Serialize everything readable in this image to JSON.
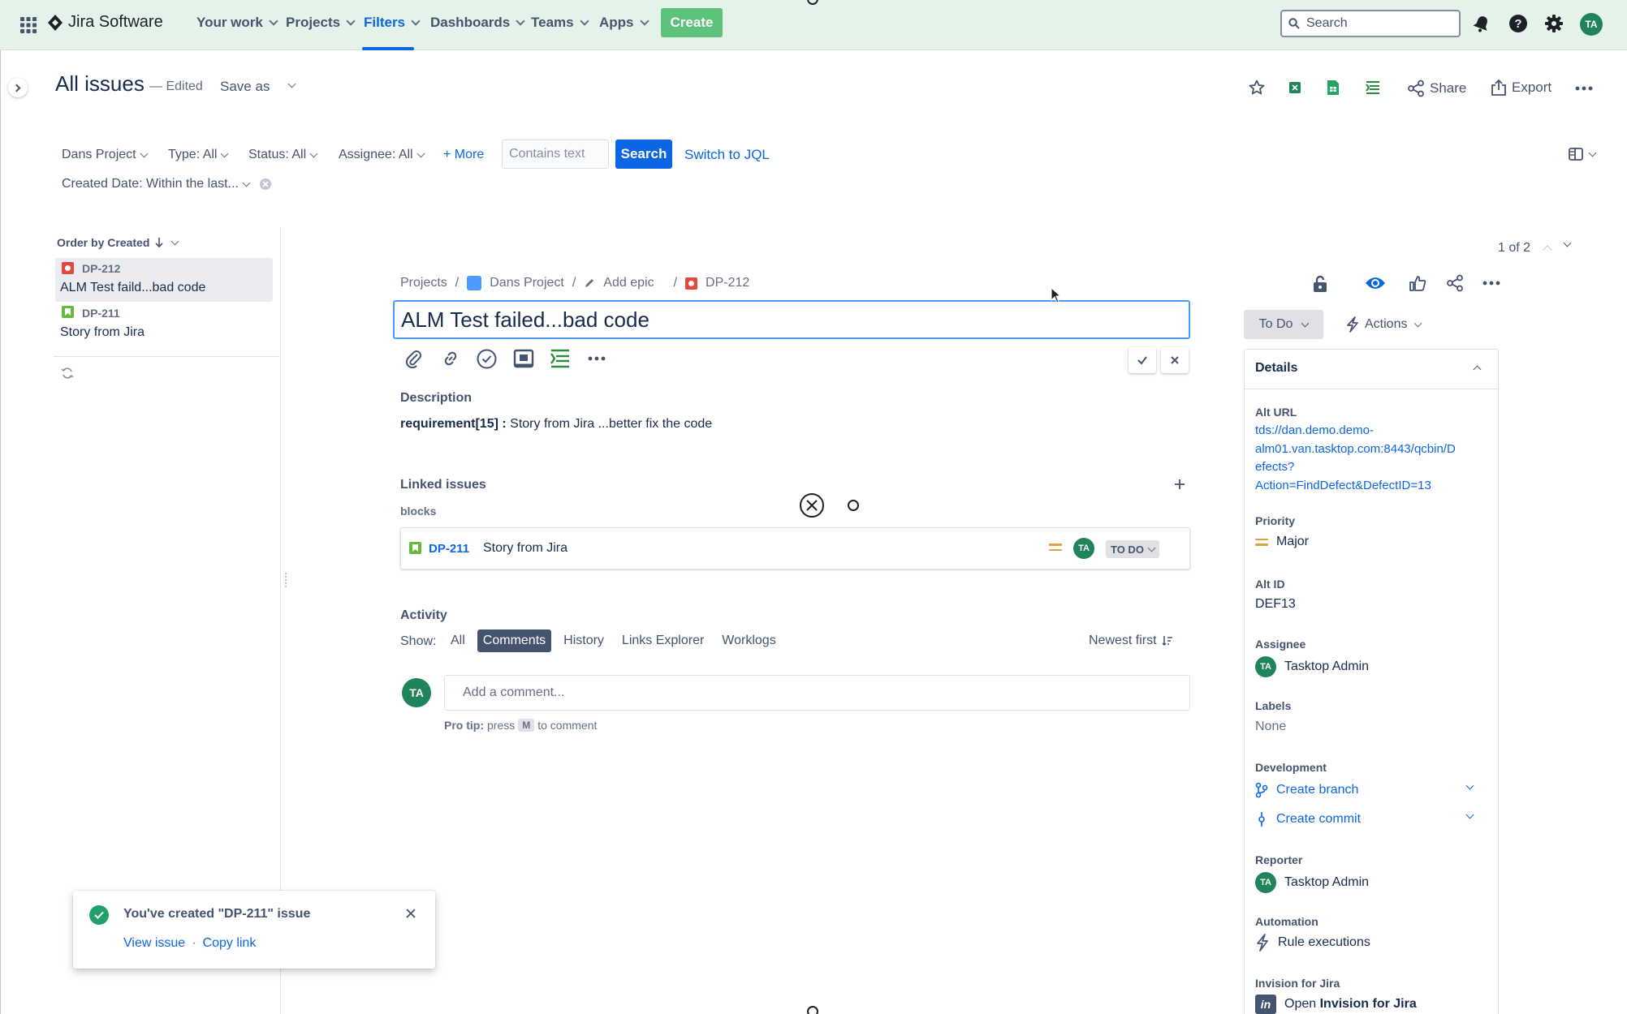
{
  "nav": {
    "app_name": "Jira Software",
    "items": [
      {
        "label": "Your work"
      },
      {
        "label": "Projects"
      },
      {
        "label": "Filters"
      },
      {
        "label": "Dashboards"
      },
      {
        "label": "Teams"
      },
      {
        "label": "Apps"
      }
    ],
    "create_label": "Create",
    "search_placeholder": "Search",
    "user_initials": "TA"
  },
  "page": {
    "title": "All issues",
    "edited_label": "— Edited",
    "save_as_label": "Save as",
    "share_label": "Share",
    "export_label": "Export"
  },
  "filters": {
    "project": "Dans Project",
    "type": "Type: All",
    "status": "Status: All",
    "assignee": "Assignee: All",
    "more": "+ More",
    "text_placeholder": "Contains text",
    "search_label": "Search",
    "switch_jql": "Switch to JQL",
    "created_date": "Created Date: Within the last..."
  },
  "issue_list": {
    "order_label": "Order by Created",
    "items": [
      {
        "key": "DP-212",
        "summary": "ALM Test faild...bad code",
        "type": "bug"
      },
      {
        "key": "DP-211",
        "summary": "Story from Jira",
        "type": "story"
      }
    ]
  },
  "pager": {
    "label": "1 of 2"
  },
  "issue": {
    "breadcrumb": {
      "projects": "Projects",
      "project": "Dans Project",
      "add_epic": "Add epic",
      "key": "DP-212"
    },
    "title_value": "ALM Test failed...bad code",
    "description_heading": "Description",
    "description_prefix": "requirement[15] :",
    "description_body": " Story from Jira ...better fix the code",
    "linked_heading": "Linked issues",
    "linked_relation": "blocks",
    "linked_item": {
      "key": "DP-211",
      "summary": "Story from Jira",
      "status": "TO DO",
      "assignee_initials": "TA"
    },
    "activity_heading": "Activity",
    "show_label": "Show:",
    "tabs": [
      "All",
      "Comments",
      "History",
      "Links Explorer",
      "Worklogs"
    ],
    "sort_label": "Newest first",
    "comment_placeholder": "Add a comment...",
    "protip_prefix": "Pro tip:",
    "protip_press": "press",
    "protip_key": "M",
    "protip_suffix": "to comment",
    "commenter_initials": "TA"
  },
  "status_button": "To Do",
  "actions_button": "Actions",
  "details": {
    "heading": "Details",
    "alt_url_label": "Alt URL",
    "alt_url_lines": [
      "tds://dan.demo.demo-",
      "alm01.van.tasktop.com:8443/qcbin/D",
      "efects?",
      "Action=FindDefect&DefectID=13"
    ],
    "priority_label": "Priority",
    "priority_value": "Major",
    "alt_id_label": "Alt ID",
    "alt_id_value": "DEF13",
    "assignee_label": "Assignee",
    "assignee_value": "Tasktop Admin",
    "assignee_initials": "TA",
    "labels_label": "Labels",
    "labels_value": "None",
    "development_label": "Development",
    "create_branch": "Create branch",
    "create_commit": "Create commit",
    "reporter_label": "Reporter",
    "reporter_value": "Tasktop Admin",
    "reporter_initials": "TA",
    "automation_label": "Automation",
    "automation_value": "Rule executions",
    "invision_label": "Invision for Jira",
    "invision_prefix": "Open ",
    "invision_value": "Invision for Jira"
  },
  "toast": {
    "message": "You've created \"DP-211\" issue",
    "view_issue": "View issue",
    "separator": "·",
    "copy_link": "Copy link"
  },
  "colors": {
    "nav_bg": "#e3f3ea",
    "brand_blue": "#0c66e4",
    "create_green": "#5dc27a",
    "bug_red": "#e2483d",
    "story_green": "#63ba3c",
    "avatar_green": "#1f845a"
  }
}
